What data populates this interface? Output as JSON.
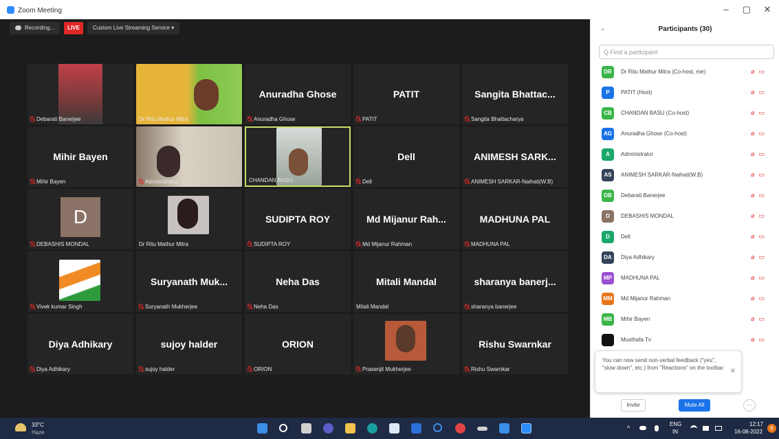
{
  "window": {
    "title": "Zoom Meeting",
    "minimize": "–",
    "restore": "▢",
    "close": "✕"
  },
  "topbar": {
    "recording": "Recording...",
    "live": "LIVE",
    "streaming": "Custom Live Streaming Service ▾"
  },
  "tiles": [
    {
      "big": "",
      "label": "Debarati Banerjee"
    },
    {
      "big": "",
      "label": "Dr Ritu Mathur Mitra"
    },
    {
      "big": "Anuradha Ghose",
      "label": "Anuradha Ghose"
    },
    {
      "big": "PATIT",
      "label": "PATIT"
    },
    {
      "big": "Sangita Bhattac...",
      "label": "Sangita Bhattacharya"
    },
    {
      "big": "Mihir Bayen",
      "label": "Mihir Bayen"
    },
    {
      "big": "",
      "label": "Administrator"
    },
    {
      "big": "",
      "label": "CHANDAN BASU"
    },
    {
      "big": "Dell",
      "label": "Dell"
    },
    {
      "big": "ANIMESH SARK...",
      "label": "ANIMESH SARKAR-Naihati(W.B)"
    },
    {
      "big": "",
      "label": "DEBASHIS MONDAL",
      "avatar": "D"
    },
    {
      "big": "",
      "label": "Dr Ritu Mathur Mitra"
    },
    {
      "big": "SUDIPTA ROY",
      "label": "SUDIPTA ROY"
    },
    {
      "big": "Md Mijanur Rah...",
      "label": "Md Mijanur Rahman"
    },
    {
      "big": "MADHUNA PAL",
      "label": "MADHUNA PAL"
    },
    {
      "big": "",
      "label": "Vivek kumar Singh"
    },
    {
      "big": "Suryanath Muk...",
      "label": "Suryanath Mukherjee"
    },
    {
      "big": "Neha Das",
      "label": "Neha Das"
    },
    {
      "big": "Mitali Mandal",
      "label": "Mitali Mandal"
    },
    {
      "big": "sharanya banerj...",
      "label": "sharanya banerjee"
    },
    {
      "big": "Diya Adhikary",
      "label": "Diya Adhikary"
    },
    {
      "big": "sujoy halder",
      "label": "sujoy halder"
    },
    {
      "big": "ORION",
      "label": "ORION"
    },
    {
      "big": "",
      "label": "Prasenjit Mukherjee"
    },
    {
      "big": "Rishu Swarnkar",
      "label": "Rishu Swarnkar"
    }
  ],
  "sidebar": {
    "title": "Participants (30)",
    "search_placeholder": "Q Find a participant",
    "participants": [
      {
        "initials": "DR",
        "name": "Dr Ritu Mathur Mitra (Co-host, me)",
        "color": "#3bb54a"
      },
      {
        "initials": "P",
        "name": "PATIT (Host)",
        "color": "#1a73e8"
      },
      {
        "initials": "CB",
        "name": "CHANDAN BASU (Co-host)",
        "color": "#3bb54a"
      },
      {
        "initials": "AG",
        "name": "Anuradha Ghose (Co-host)",
        "color": "#1a73e8"
      },
      {
        "initials": "A",
        "name": "Administrator",
        "color": "#1aa86b"
      },
      {
        "initials": "AS",
        "name": "ANIMESH SARKAR-Naihati(W.B)",
        "color": "#34435a"
      },
      {
        "initials": "DB",
        "name": "Debarati Banerjee",
        "color": "#3bb54a"
      },
      {
        "initials": "D",
        "name": "DEBASHIS MONDAL",
        "color": "#8b7266"
      },
      {
        "initials": "D",
        "name": "Dell",
        "color": "#1aa86b"
      },
      {
        "initials": "DA",
        "name": "Diya Adhikary",
        "color": "#34435a"
      },
      {
        "initials": "MP",
        "name": "MADHUNA PAL",
        "color": "#9b4fd1"
      },
      {
        "initials": "MM",
        "name": "Md Mijanur Rahman",
        "color": "#e8761a"
      },
      {
        "initials": "MB",
        "name": "Mihir Bayen",
        "color": "#3bb54a"
      },
      {
        "initials": "",
        "name": "Musthafa Tv",
        "color": "#111111"
      }
    ],
    "toast": "You can now send non-verbal feedback (\"yes\", \"slow down\", etc.) from \"Reactions\" on the toolbar.",
    "toast_close": "✕",
    "invite": "Invite",
    "mute_all": "Mute All",
    "more": "···"
  },
  "taskbar": {
    "weather_temp": "33°C",
    "weather_desc": "Haze",
    "lang": "ENG",
    "lang2": "IN",
    "time": "12:17",
    "date": "16-08-2022",
    "notif": "6"
  }
}
